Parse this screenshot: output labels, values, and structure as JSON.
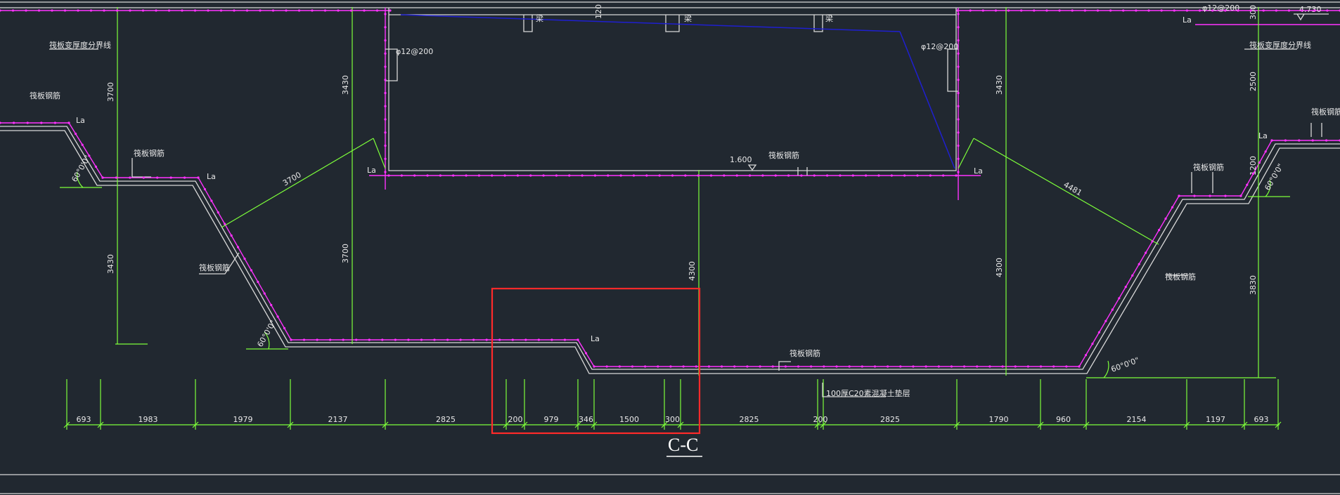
{
  "section_title": "C-C",
  "labels": {
    "zone_line_left": "筏板变厚度分界线",
    "zone_line_right": "筏板变厚度分界线",
    "raft_rebar": "筏板钢筋",
    "anchor": "La",
    "bar_spec": "φ12@200",
    "level_1": "1.600",
    "level_2": "4.730",
    "angle": "60°0'0\"",
    "cushion_note": "100厚C20素混凝土垫层",
    "keel": "梁"
  },
  "vertical_dims": {
    "left_top": "3700",
    "left_mid": "3430",
    "inner_left_top": "3430",
    "inner_left_mid": "3700",
    "center": "4300",
    "inner_right_top": "3430",
    "inner_right_mid": "4300",
    "right_top": "2500",
    "right_mid": "1200",
    "right_low": "3830",
    "top_small": "120",
    "top_right_small": "300"
  },
  "slope_dims": {
    "left": "3700",
    "right": "4481"
  },
  "bottom_dims": [
    "693",
    "1983",
    "1979",
    "2137",
    "2825",
    "200",
    "979",
    "346",
    "1500",
    "300",
    "2825",
    "200",
    "2825",
    "1790",
    "960",
    "2154",
    "1197",
    "693"
  ]
}
